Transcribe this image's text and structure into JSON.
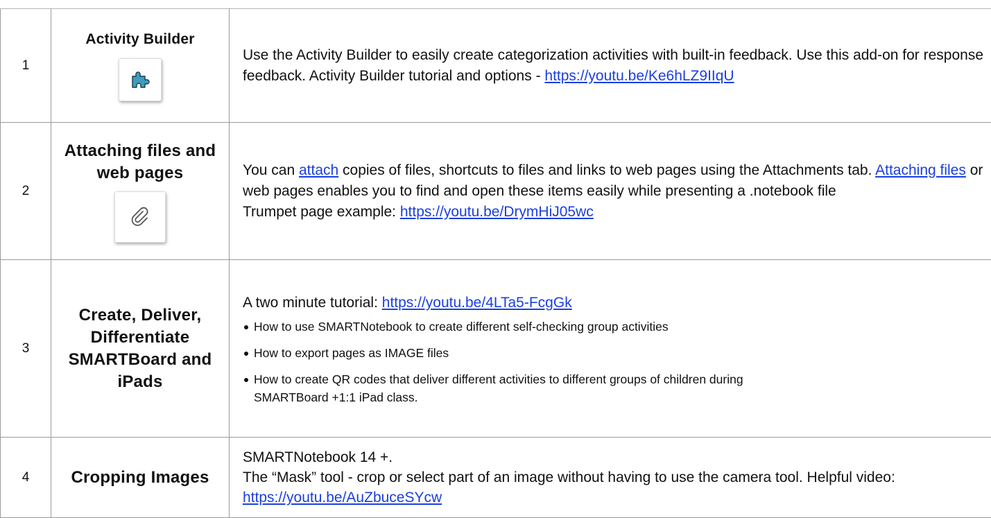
{
  "rows": [
    {
      "number": "1",
      "title": "Activity Builder",
      "icon": "puzzle-piece-icon",
      "text": "Use the Activity Builder to easily create categorization activities with built-in feedback.  Use this add-on for response feedback. Activity Builder tutorial and options - ",
      "link": "https://youtu.be/Ke6hLZ9IIqU"
    },
    {
      "number": "2",
      "title": "Attaching files and web pages",
      "icon": "paperclip-icon",
      "text_1": "You can ",
      "link_attach": "attach",
      "text_2": " copies of files, shortcuts to files and links to web pages using the Attachments tab. ",
      "link_attaching_files": "Attaching files",
      "text_3": " or web pages enables you to find and open these items easily while presenting a .notebook file",
      "example_label": "Trumpet page example: ",
      "example_link": "https://youtu.be/DrymHiJ05wc"
    },
    {
      "number": "3",
      "title": "Create, Deliver, Differentiate SMARTBoard and iPads",
      "intro": "A two minute tutorial: ",
      "link": "https://youtu.be/4LTa5-FcgGk",
      "bullets": [
        "How to use SMARTNotebook to create different self-checking group activities",
        "How to export pages as IMAGE files",
        "How to create QR codes that deliver different activities to different groups of children during SMARTBoard +1:1 iPad class."
      ]
    },
    {
      "number": "4",
      "title": "Cropping Images",
      "line_1": "SMARTNotebook 14 +.",
      "line_2": "The “Mask” tool - crop or select part of an image without having to use the camera tool. Helpful video: ",
      "link": "https://youtu.be/AuZbuceSYcw"
    }
  ],
  "colors": {
    "link": "#1a3fe0",
    "border": "#9a9a9a",
    "puzzle": "#3d9cc0"
  }
}
